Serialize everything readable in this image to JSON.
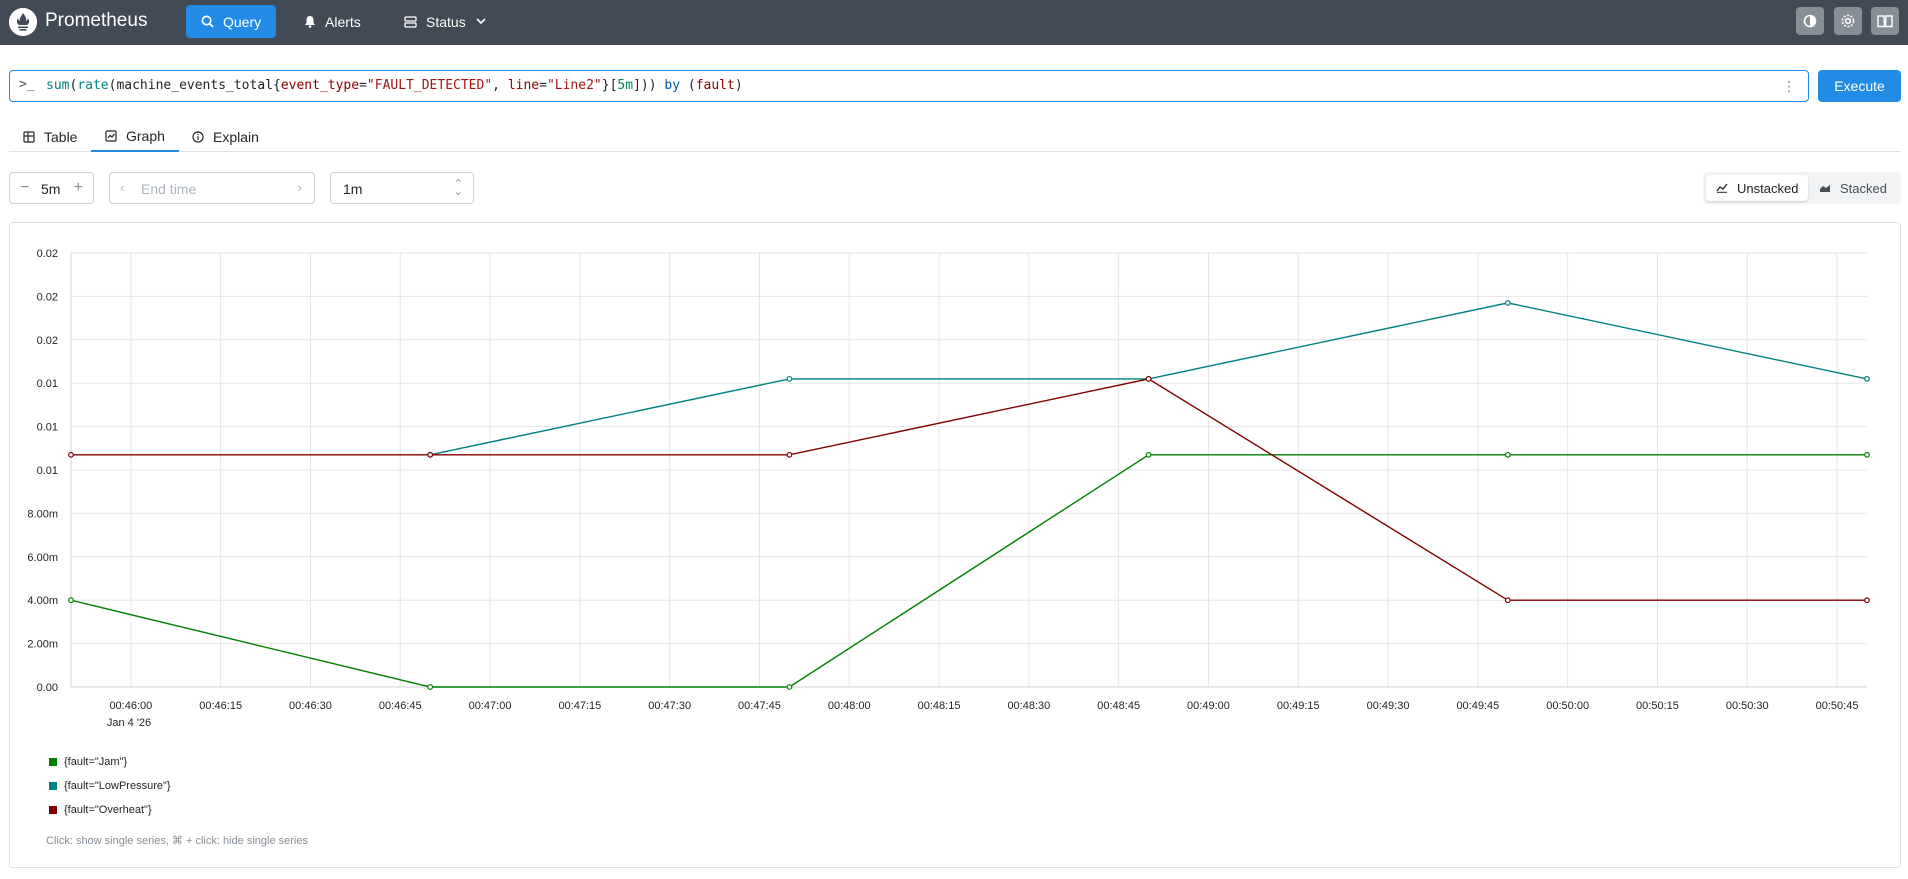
{
  "header": {
    "brand": "Prometheus",
    "nav": [
      {
        "label": "Query",
        "icon": "search-icon",
        "active": true
      },
      {
        "label": "Alerts",
        "icon": "bell-icon",
        "active": false
      },
      {
        "label": "Status",
        "icon": "server-icon",
        "active": false
      }
    ],
    "icons": [
      "theme-toggle-icon",
      "settings-gear-icon",
      "docs-book-icon"
    ],
    "colors": {
      "bar": "#414a55",
      "accent": "#228be6"
    }
  },
  "query": {
    "prompt": ">_",
    "expression": "sum(rate(machine_events_total{event_type=\"FAULT_DETECTED\", line=\"Line2\"}[5m])) by (fault)",
    "execute_label": "Execute"
  },
  "tabs": [
    {
      "label": "Table",
      "icon": "table-icon",
      "active": false
    },
    {
      "label": "Graph",
      "icon": "chart-icon",
      "active": true
    },
    {
      "label": "Explain",
      "icon": "info-icon",
      "active": false
    }
  ],
  "controls": {
    "range": "5m",
    "minus": "−",
    "plus": "+",
    "end_time_placeholder": "End time",
    "resolution": "1m",
    "unstacked_label": "Unstacked",
    "stacked_label": "Stacked",
    "stack_mode": "unstacked"
  },
  "chart_data": {
    "type": "line",
    "y_tick_labels": [
      "0.00",
      "2.00m",
      "4.00m",
      "6.00m",
      "8.00m",
      "0.01",
      "0.01",
      "0.01",
      "0.02",
      "0.02",
      "0.02"
    ],
    "x_tick_labels": [
      "00:46:00",
      "00:46:15",
      "00:46:30",
      "00:46:45",
      "00:47:00",
      "00:47:15",
      "00:47:30",
      "00:47:45",
      "00:48:00",
      "00:48:15",
      "00:48:30",
      "00:48:45",
      "00:49:00",
      "00:49:15",
      "00:49:30",
      "00:49:45",
      "00:50:00",
      "00:50:15",
      "00:50:30",
      "00:50:45"
    ],
    "x_date_label": "Jan 4 '26",
    "x": [
      "00:45:50",
      "00:46:50",
      "00:47:50",
      "00:48:50",
      "00:49:50",
      "00:50:50"
    ],
    "ylim": [
      0,
      0.02
    ],
    "grid": true,
    "legend_position": "bottom-left",
    "series": [
      {
        "name": "{fault=\"Jam\"}",
        "color": "#008000",
        "values": [
          0.004,
          0.0,
          0.0,
          0.0107,
          0.0107,
          0.0107
        ]
      },
      {
        "name": "{fault=\"LowPressure\"}",
        "color": "#008080",
        "values": [
          null,
          0.0107,
          0.0142,
          0.0142,
          0.0177,
          0.0142
        ]
      },
      {
        "name": "{fault=\"Overheat\"}",
        "color": "#800000",
        "values": [
          0.0107,
          0.0107,
          0.0107,
          0.0142,
          0.004,
          0.004
        ]
      }
    ],
    "hint": "Click: show single series, ⌘ + click: hide single series"
  }
}
